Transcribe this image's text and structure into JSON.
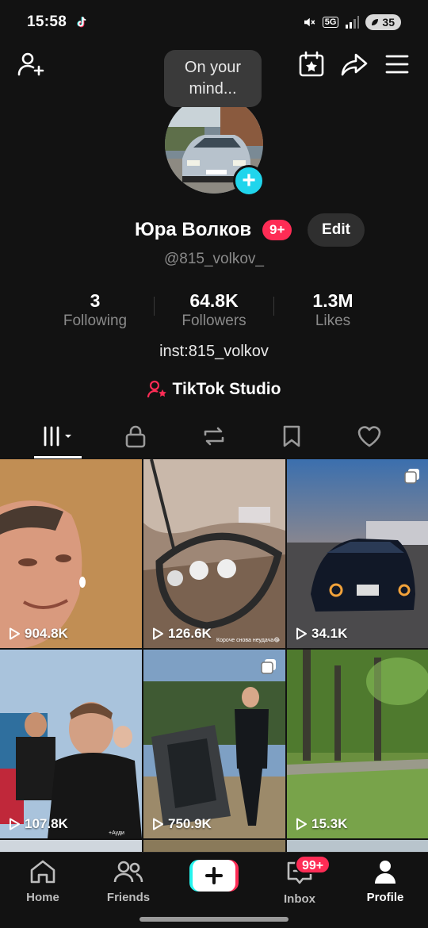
{
  "status_bar": {
    "time": "15:58",
    "network": "5G",
    "battery": "35"
  },
  "tooltip": {
    "text": "On your mind..."
  },
  "profile": {
    "display_name": "Юра Волков",
    "badge": "9+",
    "edit_label": "Edit",
    "username": "@815_volkov_",
    "bio": "inst:815_volkov",
    "studio_label": "TikTok Studio"
  },
  "stats": [
    {
      "value": "3",
      "label": "Following"
    },
    {
      "value": "64.8K",
      "label": "Followers"
    },
    {
      "value": "1.3M",
      "label": "Likes"
    }
  ],
  "tabs": [
    "videos-icon",
    "lock-icon",
    "repost-icon",
    "bookmark-icon",
    "heart-icon"
  ],
  "videos": [
    {
      "views": "904.8K",
      "multi": false
    },
    {
      "views": "126.6K",
      "multi": false,
      "caption": "Короче снова неудача😂"
    },
    {
      "views": "34.1K",
      "multi": true
    },
    {
      "views": "107.8K",
      "multi": false,
      "caption": "+Ауди"
    },
    {
      "views": "750.9K",
      "multi": true
    },
    {
      "views": "15.3K",
      "multi": false
    }
  ],
  "bottom_nav": {
    "home": "Home",
    "friends": "Friends",
    "inbox": "Inbox",
    "inbox_badge": "99+",
    "profile": "Profile"
  },
  "colors": {
    "background": "#121212",
    "accent_red": "#fe2c55",
    "accent_cyan": "#20d5ec",
    "muted_text": "#8a8a8a"
  }
}
